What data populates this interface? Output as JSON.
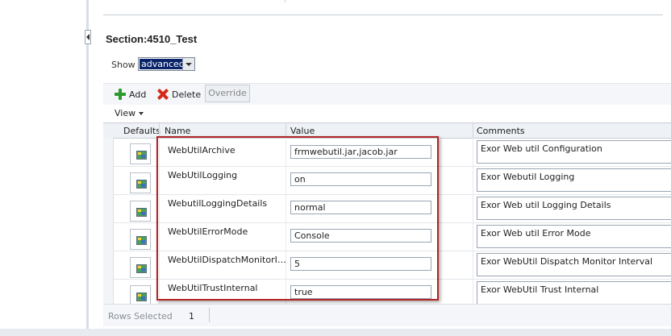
{
  "section": {
    "title": "Section:4510_Test"
  },
  "show": {
    "label": "Show",
    "selected": "advanced"
  },
  "toolbar": {
    "add_label": "Add",
    "delete_label": "Delete",
    "override_label": "Override",
    "view_label": "View"
  },
  "table": {
    "columns": {
      "defaults": "Defaults",
      "name": "Name",
      "value": "Value",
      "comments": "Comments"
    },
    "rows": [
      {
        "name": "WebUtilArchive",
        "value": "frmwebutil.jar,jacob.jar",
        "comment": "Exor Web util Configuration"
      },
      {
        "name": "WebUtilLogging",
        "value": "on",
        "comment": "Exor Webutil Logging"
      },
      {
        "name": "WebutilLoggingDetails",
        "value": "normal",
        "comment": "Exor Web util Logging Details"
      },
      {
        "name": "WebUtilErrorMode",
        "value": "Console",
        "comment": "Exor Web util Error Mode"
      },
      {
        "name": "WebUtilDispatchMonitorInte...",
        "value": "5",
        "comment": "Exor WebUtil Dispatch Monitor Interval"
      },
      {
        "name": "WebUtilTrustInternal",
        "value": "true",
        "comment": "Exor WebUtil Trust Internal"
      }
    ]
  },
  "status": {
    "rows_selected_label": "Rows Selected",
    "rows_selected_count": "1"
  },
  "icons": {
    "add": "plus-icon",
    "delete": "x-icon",
    "defaults": "default-image-icon",
    "view": "chevron-down-icon"
  },
  "colors": {
    "highlight": "#b02525",
    "add_icon": "#2c9a2c",
    "delete_icon": "#d42a1a",
    "select_highlight": "#0a246a"
  }
}
